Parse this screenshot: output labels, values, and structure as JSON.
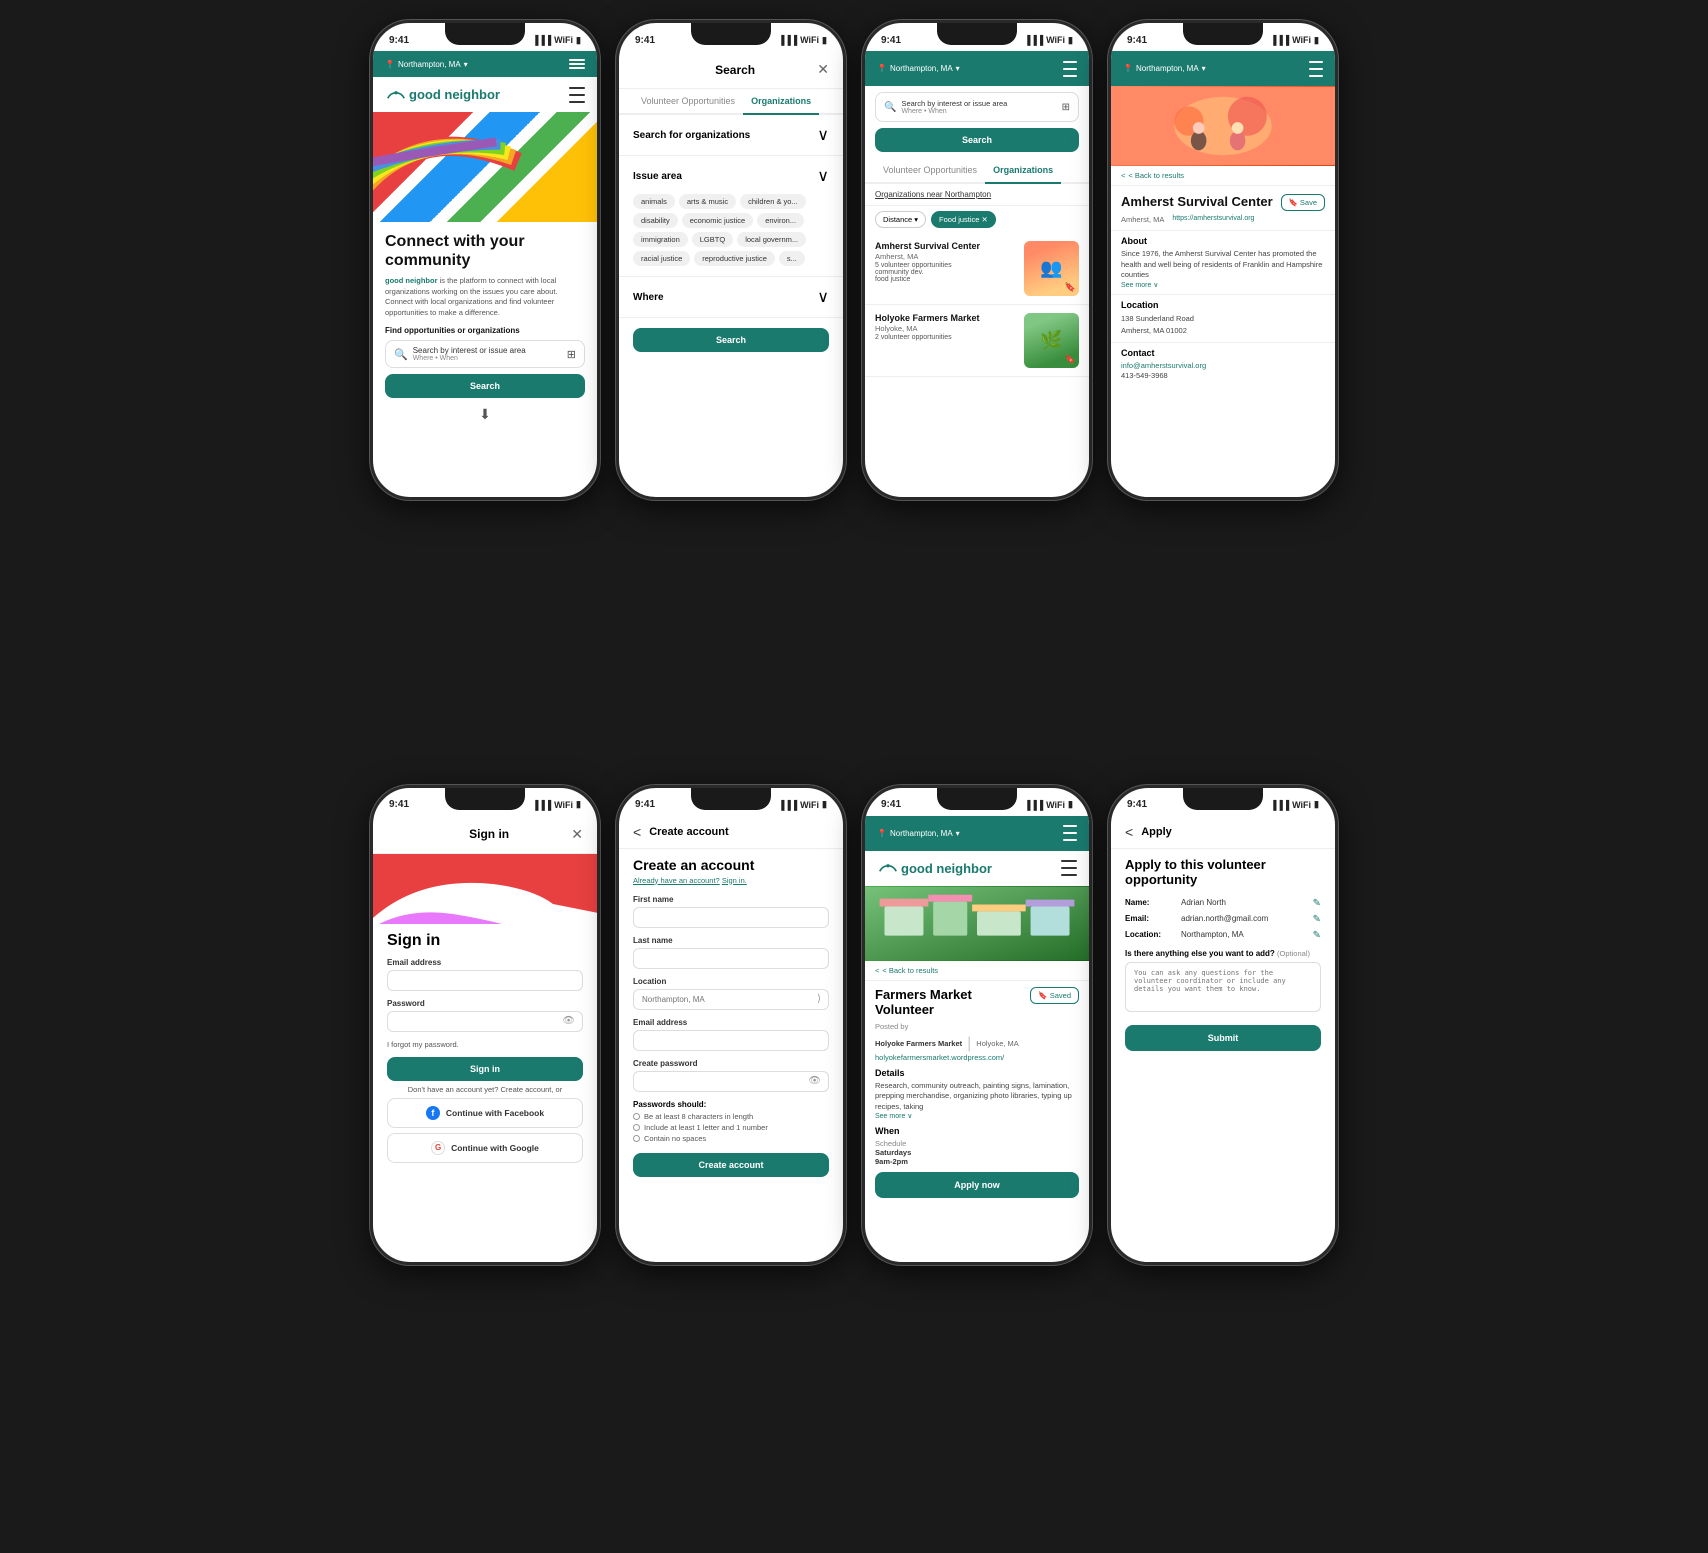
{
  "phones": {
    "row1": [
      {
        "id": "home",
        "screen": "home",
        "status": {
          "time": "9:41"
        },
        "location": "Northampton, MA",
        "hero_title": "Connect with your community",
        "hero_subtitle_brand": "good neighbor",
        "hero_subtitle_text": " is the platform to connect with local organizations working on the issues you care about. Connect with local organizations and find volunteer opportunities to make a difference.",
        "find_label": "Find opportunities or organizations",
        "search_main": "Search by interest or issue area",
        "search_sub": "Where • When",
        "search_btn": "Search",
        "filters_icon": "⊞"
      },
      {
        "id": "search-modal",
        "screen": "search-modal",
        "status": {
          "time": "9:41"
        },
        "title": "Search",
        "close": "✕",
        "tabs": [
          "Volunteer Opportunities",
          "Organizations"
        ],
        "active_tab": "Organizations",
        "sections": [
          {
            "title": "Search for organizations",
            "type": "dropdown"
          },
          {
            "title": "Issue area",
            "type": "accordion",
            "tags": [
              "animals",
              "arts & music",
              "children & yo...",
              "disability",
              "economic justice",
              "environ...",
              "immigration",
              "LGBTQ",
              "local governm...",
              "racial justice",
              "reproductive justice",
              "s..."
            ]
          },
          {
            "title": "Where",
            "type": "accordion"
          }
        ],
        "search_btn": "Search"
      },
      {
        "id": "results",
        "screen": "results",
        "status": {
          "time": "9:41"
        },
        "location": "Northampton, MA",
        "search_placeholder": "Search by interest or issue area",
        "search_sub": "Where • When",
        "search_btn": "Search",
        "tabs": [
          "Volunteer Opportunities",
          "Organizations"
        ],
        "active_tab": "Organizations",
        "results_header": "Organizations near Northampton",
        "filters": [
          "Distance ▾",
          "Food justice ✕"
        ],
        "orgs": [
          {
            "name": "Amherst Survival Center",
            "location": "Amherst, MA",
            "vol_opps": "5 volunteer opportunities",
            "tags": [
              "community dev.",
              "food justice"
            ],
            "img_type": "amherst"
          },
          {
            "name": "Holyoke Farmers Market",
            "location": "Holyoke, MA",
            "vol_opps": "2 volunteer opportunities",
            "tags": [],
            "img_type": "farmers"
          }
        ]
      },
      {
        "id": "org-detail",
        "screen": "org-detail",
        "status": {
          "time": "9:41"
        },
        "location": "Northampton, MA",
        "back_text": "< Back to results",
        "org_name": "Amherst Survival Center",
        "save_btn": "Save",
        "org_city": "Amherst, MA",
        "org_website": "https://amherstsurvival.org",
        "about_title": "About",
        "about_text": "Since 1976, the Amherst Survival Center has promoted the health and well being of residents of Franklin and Hampshire counties",
        "see_more": "See more ∨",
        "location_title": "Location",
        "address": "138 Sunderland Road\nAmherst, MA 01002",
        "contact_title": "Contact",
        "email": "info@amherstsurvival.org",
        "phone": "413-549-3968"
      }
    ],
    "row2": [
      {
        "id": "signin",
        "screen": "signin",
        "status": {
          "time": "9:41"
        },
        "title": "Sign in",
        "close": "✕",
        "big_title": "Sign in",
        "email_label": "Email address",
        "password_label": "Password",
        "forgot": "I forgot my password.",
        "signin_btn": "Sign in",
        "no_account": "Don't have an account yet? Create account, or",
        "facebook_btn": "Continue with Facebook",
        "google_btn": "Continue with Google"
      },
      {
        "id": "create-account",
        "screen": "create-account",
        "status": {
          "time": "9:41"
        },
        "back_label": "Back",
        "title": "Create account",
        "big_title": "Create an account",
        "already_text": "Already have an account?",
        "sign_in_link": "Sign in.",
        "first_name_label": "First name",
        "last_name_label": "Last name",
        "location_label": "Location",
        "location_placeholder": "Northampton, MA",
        "email_label": "Email address",
        "password_label": "Create password",
        "rules_title": "Passwords should:",
        "rules": [
          "Be at least 8 characters in length",
          "Include at least 1 letter and 1 number",
          "Contain no spaces"
        ],
        "create_btn": "Create account"
      },
      {
        "id": "vol-detail",
        "screen": "vol-detail",
        "status": {
          "time": "9:41"
        },
        "location": "Northampton, MA",
        "back_text": "< Back to results",
        "vol_title": "Farmers Market Volunteer",
        "saved_btn": "Saved",
        "posted_by": "Posted by",
        "org_name": "Holyoke Farmers Market",
        "org_location": "Holyoke, MA",
        "website": "holyokefarmersmarket.wordpress.com/",
        "details_title": "Details",
        "details_text": "Research, community outreach, painting signs, lamination, prepping merchandise, organizing photo libraries, typing up recipes, taking",
        "see_more": "See more ∨",
        "when_title": "When",
        "schedule_label": "Schedule",
        "schedule_value": "Saturdays\n9am-2pm",
        "apply_btn": "Apply now"
      },
      {
        "id": "apply",
        "screen": "apply",
        "status": {
          "time": "9:41"
        },
        "back_label": "Back",
        "title": "Apply",
        "big_title": "Apply to this volunteer opportunity",
        "name_label": "Name:",
        "name_value": "Adrian North",
        "email_label": "Email:",
        "email_value": "adrian.north@gmail.com",
        "location_label": "Location:",
        "location_value": "Northampton, MA",
        "optional_label": "Is there anything else you want to add?",
        "optional_sub": "(Optional)",
        "textarea_placeholder": "You can ask any questions for the volunteer coordinator or include any details you want them to know.",
        "submit_btn": "Submit"
      }
    ]
  }
}
